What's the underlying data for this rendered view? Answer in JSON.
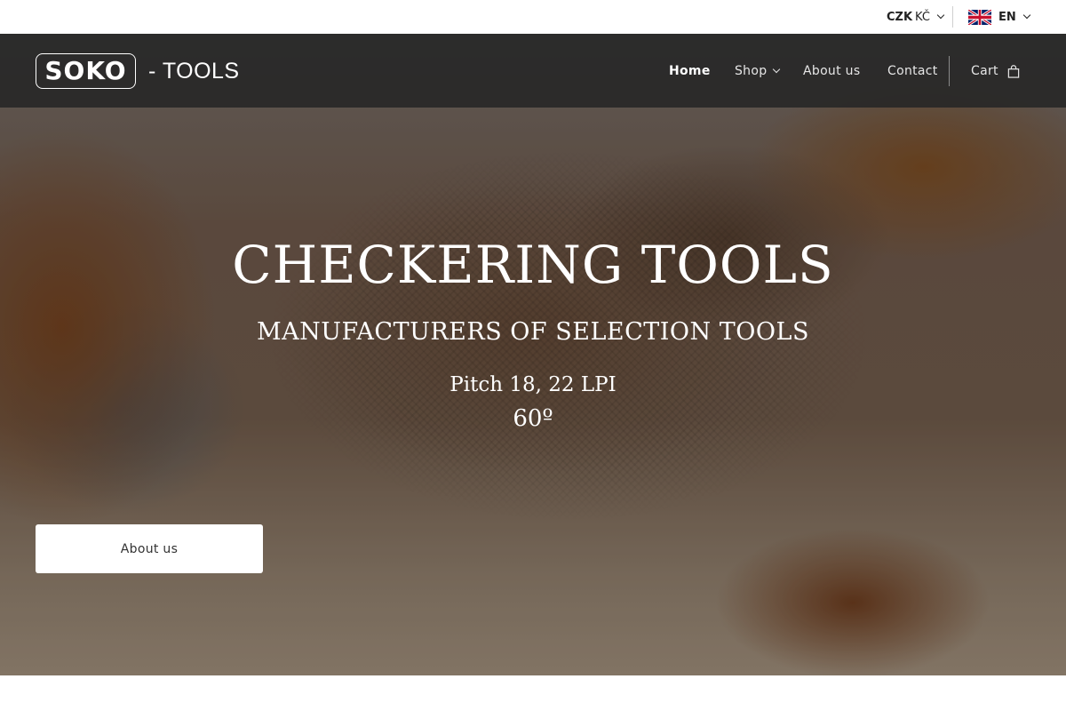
{
  "topbar": {
    "currency_code": "CZK",
    "currency_symbol": "KČ",
    "language": "EN"
  },
  "header": {
    "logo_text": "SOKO",
    "logo_suffix": "- TOOLS",
    "nav": {
      "home": "Home",
      "shop": "Shop",
      "about": "About us",
      "contact": "Contact",
      "cart": "Cart"
    }
  },
  "hero": {
    "title": "CHECKERING TOOLS",
    "subtitle": "MANUFACTURERS OF SELECTION TOOLS",
    "line1": "Pitch 18, 22 LPI",
    "line2": "60º",
    "cta_label": "About us"
  },
  "colors": {
    "nav_bg": "#262626",
    "cta_bg": "#ffffff",
    "text_light": "#ffffff"
  },
  "icons": {
    "currency_chevron": "chevron-down-icon",
    "language_flag": "uk-flag-icon",
    "shop_chevron": "chevron-down-icon",
    "cart": "shopping-bag-icon"
  }
}
